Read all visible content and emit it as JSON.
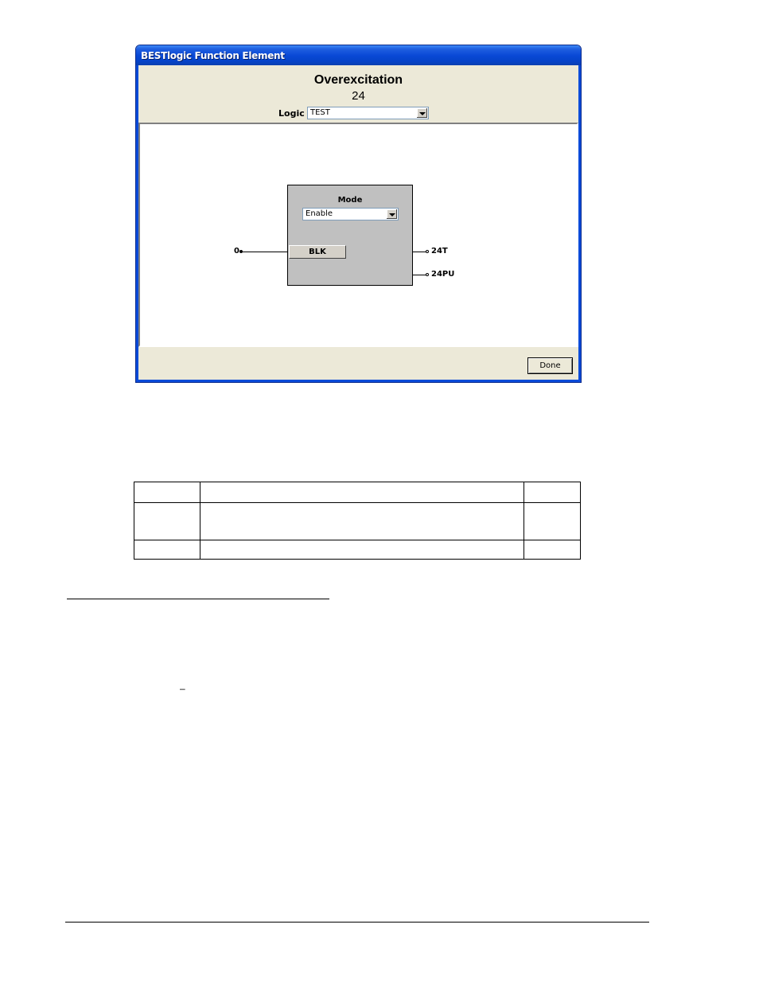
{
  "window": {
    "title": "BESTlogic Function Element",
    "heading": "Overexcitation",
    "subheading": "24",
    "logic_label": "Logic",
    "logic_value": "TEST",
    "done_label": "Done"
  },
  "element": {
    "mode_label": "Mode",
    "mode_value": "Enable",
    "block_input_label": "BLK",
    "input_value": "0",
    "outputs": [
      "24T",
      "24PU"
    ]
  },
  "table": {
    "rows": [
      [
        "",
        "",
        ""
      ],
      [
        "",
        "",
        ""
      ],
      [
        "",
        "",
        ""
      ]
    ]
  },
  "footnote_mark": "–"
}
